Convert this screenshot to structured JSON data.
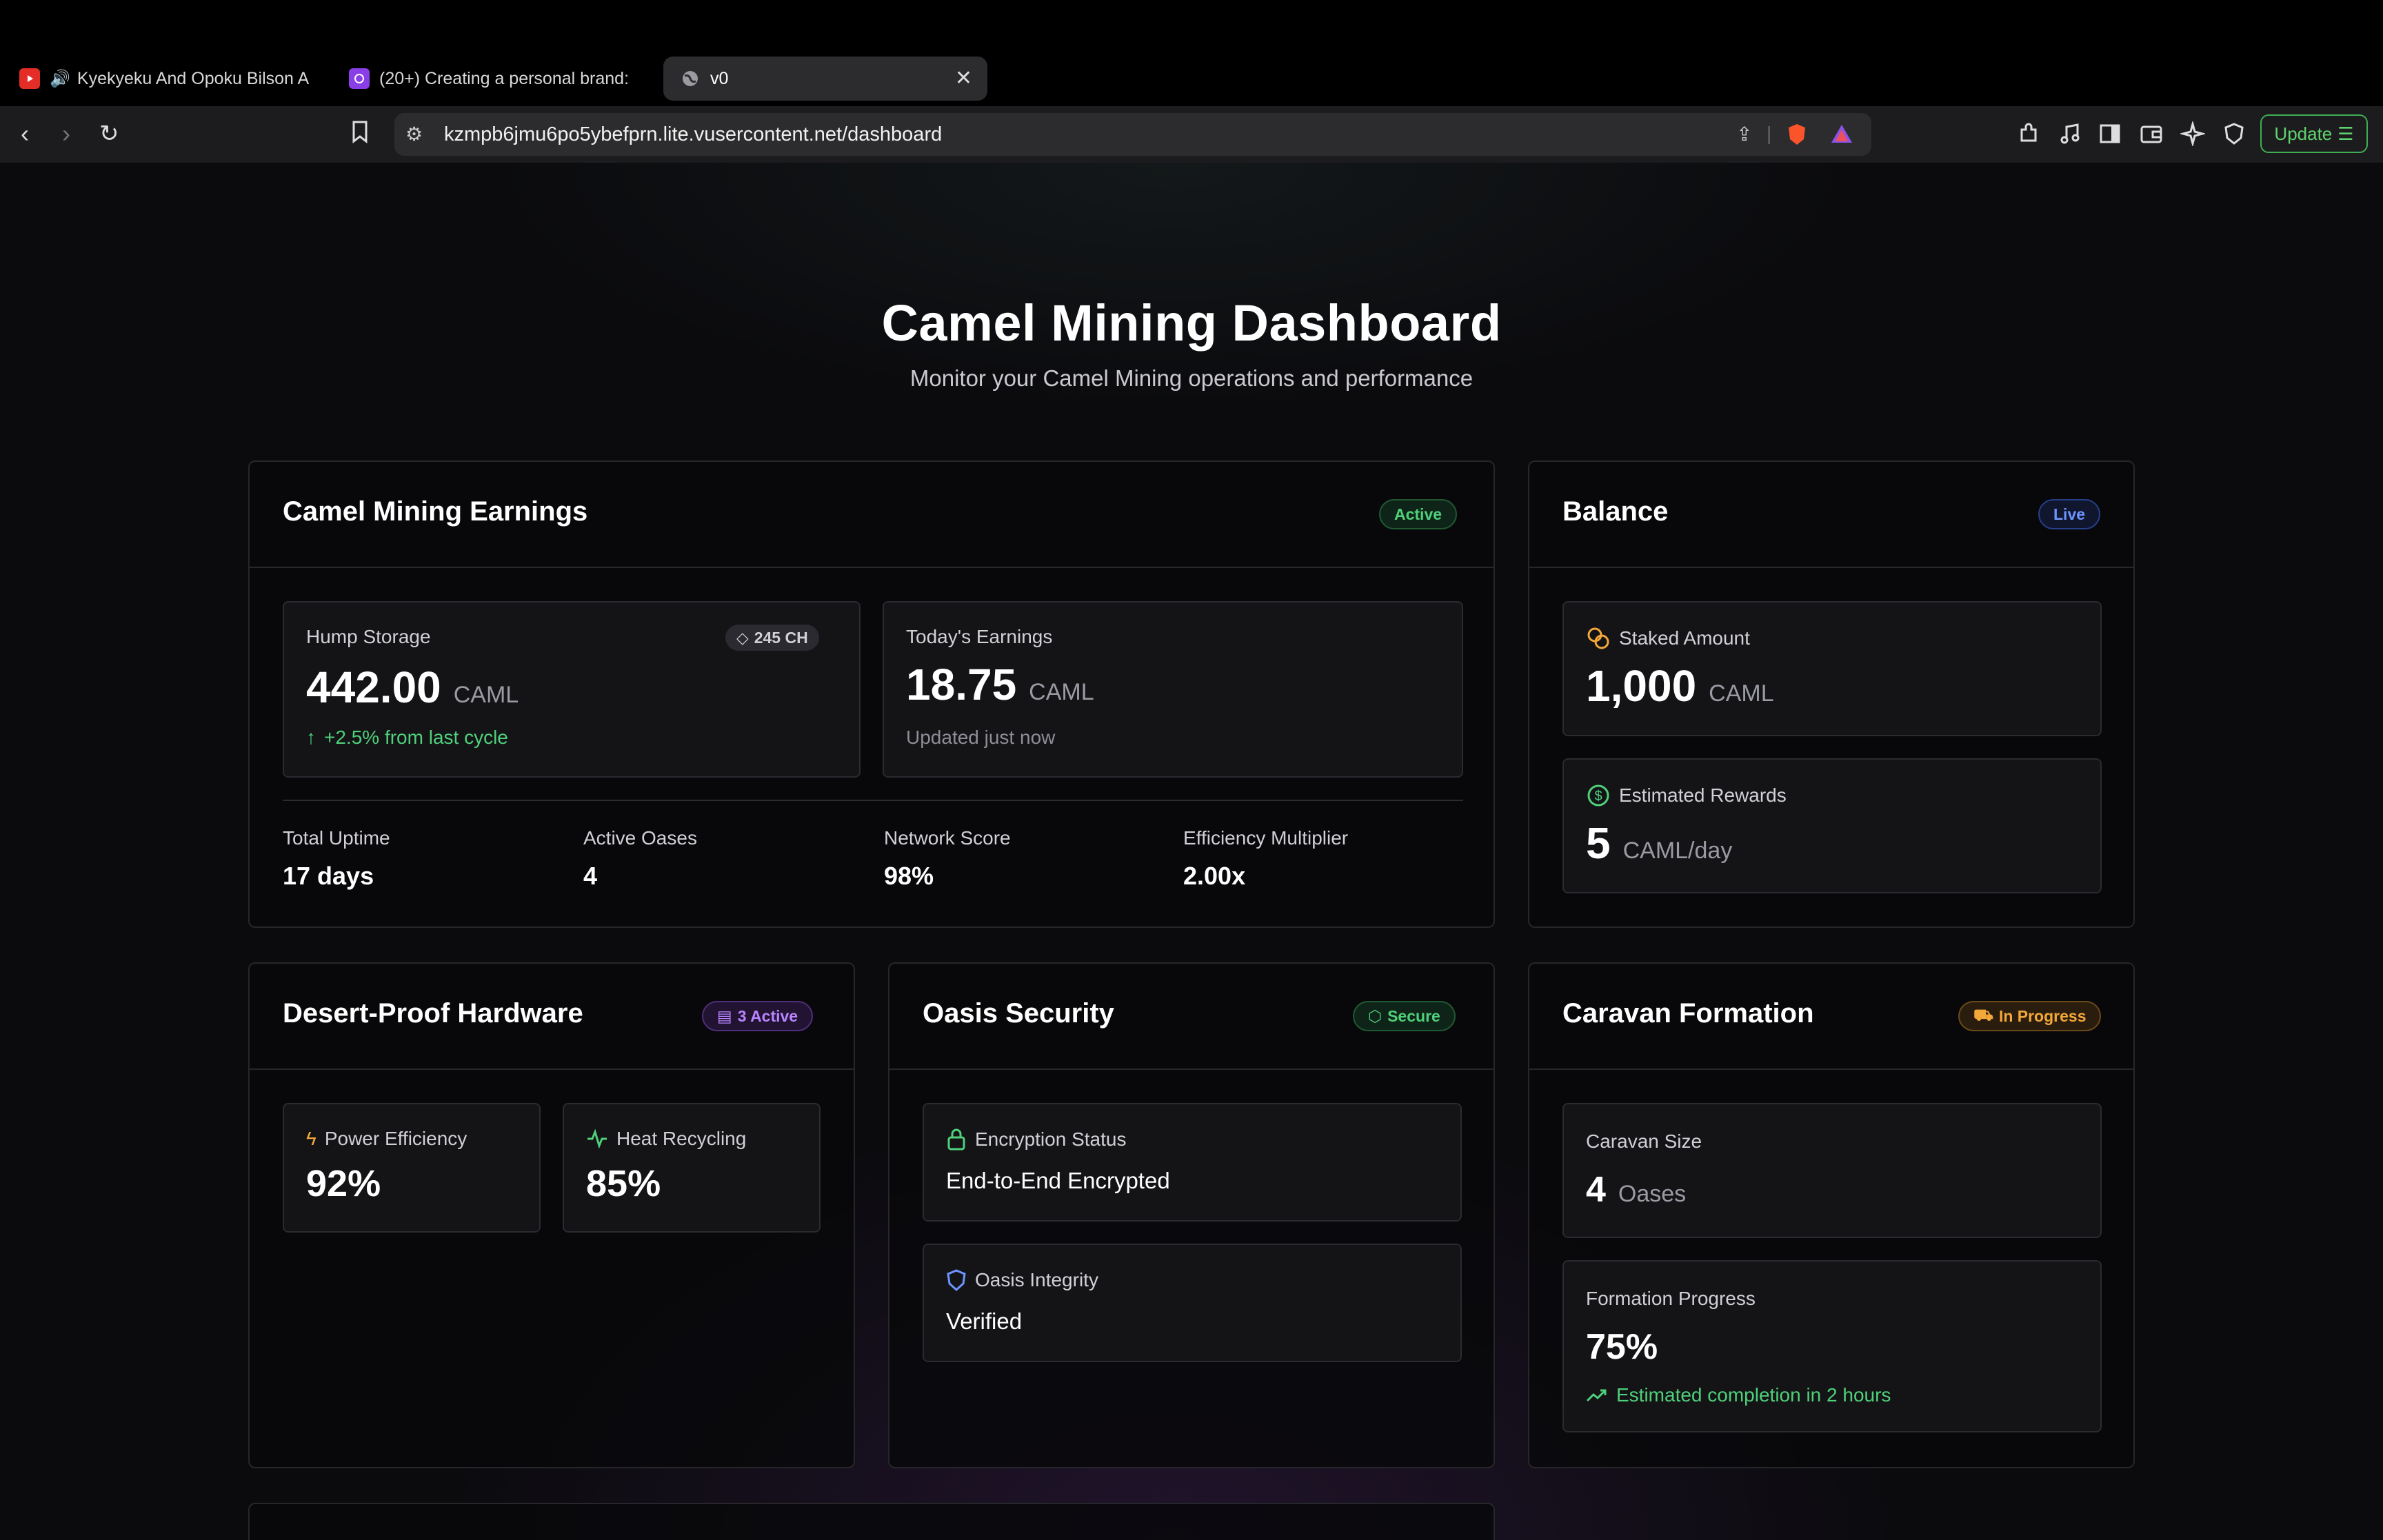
{
  "browser": {
    "tabs": [
      {
        "title": "Kyekyeku And Opoku Bilson A",
        "icon": "youtube-icon"
      },
      {
        "title": "(20+) Creating a personal brand:",
        "icon": "app-icon"
      },
      {
        "title": "v0",
        "icon": "globe-icon",
        "active": true
      }
    ],
    "url": "kzmpb6jmu6po5ybefprn.lite.vusercontent.net/dashboard",
    "update_label": "Update"
  },
  "header": {
    "title": "Camel Mining Dashboard",
    "subtitle": "Monitor your Camel Mining operations and performance"
  },
  "earnings": {
    "title": "Camel Mining Earnings",
    "badge": "Active",
    "hump_storage": {
      "label": "Hump Storage",
      "chip": "245 CH",
      "value": "442.00",
      "unit": "CAML",
      "change": "+2.5% from last cycle"
    },
    "today": {
      "label": "Today's Earnings",
      "value": "18.75",
      "unit": "CAML",
      "note": "Updated just now"
    },
    "stats": [
      {
        "label": "Total Uptime",
        "value": "17 days"
      },
      {
        "label": "Active Oases",
        "value": "4"
      },
      {
        "label": "Network Score",
        "value": "98%"
      },
      {
        "label": "Efficiency Multiplier",
        "value": "2.00x"
      }
    ]
  },
  "balance": {
    "title": "Balance",
    "badge": "Live",
    "staked": {
      "label": "Staked Amount",
      "value": "1,000",
      "unit": "CAML"
    },
    "rewards": {
      "label": "Estimated Rewards",
      "value": "5",
      "unit": "CAML/day"
    }
  },
  "hardware": {
    "title": "Desert-Proof Hardware",
    "badge": "3 Active",
    "power": {
      "label": "Power Efficiency",
      "value": "92%"
    },
    "heat": {
      "label": "Heat Recycling",
      "value": "85%"
    }
  },
  "security": {
    "title": "Oasis Security",
    "badge": "Secure",
    "encryption": {
      "label": "Encryption Status",
      "value": "End-to-End Encrypted"
    },
    "integrity": {
      "label": "Oasis Integrity",
      "value": "Verified"
    }
  },
  "caravan": {
    "title": "Caravan Formation",
    "badge": "In Progress",
    "size": {
      "label": "Caravan Size",
      "value": "4",
      "unit": "Oases"
    },
    "progress": {
      "label": "Formation Progress",
      "value": "75%",
      "note": "Estimated completion in 2 hours"
    }
  },
  "colors": {
    "accent_green": "#4fd07a",
    "accent_blue": "#6e95ff",
    "accent_purple": "#b884ff",
    "accent_orange": "#f4a83a"
  }
}
